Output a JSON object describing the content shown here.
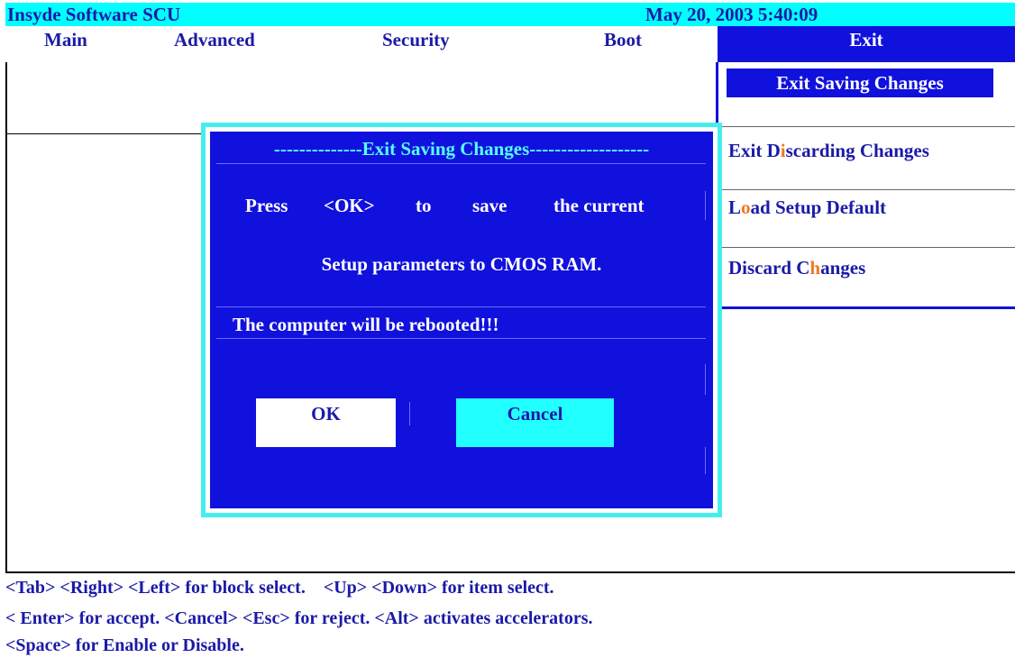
{
  "title_bar": {
    "app_name": "Insyde Software SCU",
    "datetime": "May 20, 2003 5:40:09"
  },
  "menu": {
    "items": [
      "Main",
      "Advanced",
      "Security",
      "Boot",
      "Exit"
    ],
    "selected": "Exit"
  },
  "exit_panel": {
    "selected_item": "Exit Saving Changes",
    "items": [
      {
        "pre": "Exit D",
        "accel": "i",
        "post": "scarding Changes"
      },
      {
        "pre": "L",
        "accel": "o",
        "post": "ad Setup Default"
      },
      {
        "pre": "Discard C",
        "accel": "h",
        "post": "anges"
      }
    ]
  },
  "dialog": {
    "title": "--------------Exit Saving Changes-------------------",
    "line1": {
      "w1": "Press",
      "w2": "<OK>",
      "w3": "to",
      "w4": "save",
      "w5": "the current"
    },
    "line2": "Setup parameters to CMOS RAM.",
    "line3": "The computer will be rebooted!!!",
    "ok_label": "OK",
    "cancel_label": "Cancel"
  },
  "help": {
    "line1": "<Tab> <Right> <Left> for block select.    <Up> <Down> for item select.",
    "line2": "< Enter> for accept. <Cancel> <Esc> for reject. <Alt> activates accelerators.",
    "line3": "<Space> for Enable or Disable."
  },
  "colors": {
    "dialog_bg": "#1111dd",
    "title_bg": "#00ffff",
    "accent_text": "#1a1aa8",
    "accelerator": "#f07820"
  }
}
